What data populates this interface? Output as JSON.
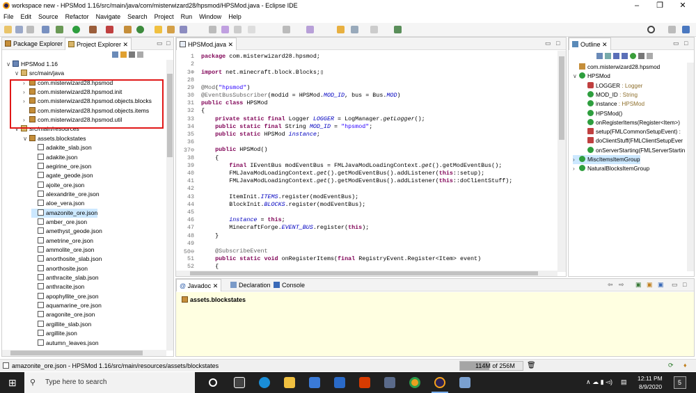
{
  "window": {
    "title": "workspace new - HPSMod 1.16/src/main/java/com/misterwizard28/hpsmod/HPSMod.java - Eclipse IDE",
    "minimize": "–",
    "restore": "❐",
    "close": "✕"
  },
  "menu": [
    "File",
    "Edit",
    "Source",
    "Refactor",
    "Navigate",
    "Search",
    "Project",
    "Run",
    "Window",
    "Help"
  ],
  "left_panel": {
    "tabs": [
      "Package Explorer",
      "Project Explorer"
    ],
    "tree": [
      {
        "label": "HPSMod 1.16",
        "indent": 0,
        "icon": "project",
        "arrow": "∨"
      },
      {
        "label": "src/main/java",
        "indent": 1,
        "icon": "folder",
        "arrow": "∨"
      },
      {
        "label": "com.misterwizard28.hpsmod",
        "indent": 2,
        "icon": "package",
        "arrow": "›"
      },
      {
        "label": "com.misterwizard28.hpsmod.init",
        "indent": 2,
        "icon": "package",
        "arrow": "›"
      },
      {
        "label": "com.misterwizard28.hpsmod.objects.blocks",
        "indent": 2,
        "icon": "package",
        "arrow": "›"
      },
      {
        "label": "com.misterwizard28.hpsmod.objects.items",
        "indent": 2,
        "icon": "package",
        "arrow": ""
      },
      {
        "label": "com.misterwizard28.hpsmod.util",
        "indent": 2,
        "icon": "package",
        "arrow": "›"
      },
      {
        "label": "src/main/resources",
        "indent": 1,
        "icon": "folder",
        "arrow": "∨"
      },
      {
        "label": "assets.blockstates",
        "indent": 2,
        "icon": "package",
        "arrow": "∨"
      },
      {
        "label": "adakite_slab.json",
        "indent": 3,
        "icon": "file",
        "arrow": ""
      },
      {
        "label": "adakite.json",
        "indent": 3,
        "icon": "file",
        "arrow": ""
      },
      {
        "label": "aegirine_ore.json",
        "indent": 3,
        "icon": "file",
        "arrow": ""
      },
      {
        "label": "agate_geode.json",
        "indent": 3,
        "icon": "file",
        "arrow": ""
      },
      {
        "label": "ajoite_ore.json",
        "indent": 3,
        "icon": "file",
        "arrow": ""
      },
      {
        "label": "alexandrite_ore.json",
        "indent": 3,
        "icon": "file",
        "arrow": ""
      },
      {
        "label": "aloe_vera.json",
        "indent": 3,
        "icon": "file",
        "arrow": ""
      },
      {
        "label": "amazonite_ore.json",
        "indent": 3,
        "icon": "file",
        "arrow": "",
        "selected": true
      },
      {
        "label": "amber_ore.json",
        "indent": 3,
        "icon": "file",
        "arrow": ""
      },
      {
        "label": "amethyst_geode.json",
        "indent": 3,
        "icon": "file",
        "arrow": ""
      },
      {
        "label": "ametrine_ore.json",
        "indent": 3,
        "icon": "file",
        "arrow": ""
      },
      {
        "label": "ammolite_ore.json",
        "indent": 3,
        "icon": "file",
        "arrow": ""
      },
      {
        "label": "anorthosite_slab.json",
        "indent": 3,
        "icon": "file",
        "arrow": ""
      },
      {
        "label": "anorthosite.json",
        "indent": 3,
        "icon": "file",
        "arrow": ""
      },
      {
        "label": "anthracite_slab.json",
        "indent": 3,
        "icon": "file",
        "arrow": ""
      },
      {
        "label": "anthracite.json",
        "indent": 3,
        "icon": "file",
        "arrow": ""
      },
      {
        "label": "apophyllite_ore.json",
        "indent": 3,
        "icon": "file",
        "arrow": ""
      },
      {
        "label": "aquamarine_ore.json",
        "indent": 3,
        "icon": "file",
        "arrow": ""
      },
      {
        "label": "aragonite_ore.json",
        "indent": 3,
        "icon": "file",
        "arrow": ""
      },
      {
        "label": "argillite_slab.json",
        "indent": 3,
        "icon": "file",
        "arrow": ""
      },
      {
        "label": "argillite.json",
        "indent": 3,
        "icon": "file",
        "arrow": ""
      },
      {
        "label": "autumn_leaves.json",
        "indent": 3,
        "icon": "file",
        "arrow": ""
      }
    ]
  },
  "editor": {
    "tab": "HPSMod.java",
    "lines": [
      {
        "n": "1",
        "html": "<span class=\"kw\">package</span> com.misterwizard28.hpsmod;"
      },
      {
        "n": "2",
        "html": ""
      },
      {
        "n": "3⊕",
        "html": "<span class=\"kw\">import</span> net.minecraft.block.Blocks;▯"
      },
      {
        "n": "28",
        "html": ""
      },
      {
        "n": "29",
        "html": "<span class=\"an\">@Mod</span>(<span class=\"st\">\"hpsmod\"</span>)"
      },
      {
        "n": "30",
        "html": "<span class=\"an\">@EventBusSubscriber</span>(modid = HPSMod.<span class=\"fi\">MOD_ID</span>, bus = Bus.<span class=\"fi\">MOD</span>)"
      },
      {
        "n": "31",
        "html": "<span class=\"kw\">public class</span> HPSMod"
      },
      {
        "n": "32",
        "html": "{"
      },
      {
        "n": "33",
        "html": "    <span class=\"kw\">private static final</span> Logger <span class=\"fi\">LOGGER</span> = LogManager.<span class=\"it\">getLogger</span>();"
      },
      {
        "n": "34",
        "html": "    <span class=\"kw\">public static final</span> String <span class=\"fi\">MOD_ID</span> = <span class=\"st\">\"hpsmod\"</span>;"
      },
      {
        "n": "35",
        "html": "    <span class=\"kw\">public static</span> HPSMod <span class=\"fi\">instance</span>;"
      },
      {
        "n": "36",
        "html": ""
      },
      {
        "n": "37⊖",
        "html": "    <span class=\"kw\">public</span> HPSMod()"
      },
      {
        "n": "38",
        "html": "    {"
      },
      {
        "n": "39",
        "html": "        <span class=\"kw\">final</span> IEventBus modEventBus = FMLJavaModLoadingContext.<span class=\"it\">get</span>().getModEventBus();"
      },
      {
        "n": "40",
        "html": "        FMLJavaModLoadingContext.<span class=\"it\">get</span>().getModEventBus().addListener(<span class=\"kw\">this</span>::setup);"
      },
      {
        "n": "41",
        "html": "        FMLJavaModLoadingContext.<span class=\"it\">get</span>().getModEventBus().addListener(<span class=\"kw\">this</span>::doClientStuff);"
      },
      {
        "n": "42",
        "html": ""
      },
      {
        "n": "43",
        "html": "        ItemInit.<span class=\"fi\">ITEMS</span>.register(modEventBus);"
      },
      {
        "n": "44",
        "html": "        BlockInit.<span class=\"fi\">BLOCKS</span>.register(modEventBus);"
      },
      {
        "n": "45",
        "html": ""
      },
      {
        "n": "46",
        "html": "        <span class=\"fi\">instance</span> = <span class=\"kw\">this</span>;"
      },
      {
        "n": "47",
        "html": "        MinecraftForge.<span class=\"fi\">EVENT_BUS</span>.register(<span class=\"kw\">this</span>);"
      },
      {
        "n": "48",
        "html": "    }"
      },
      {
        "n": "49",
        "html": ""
      },
      {
        "n": "50⊖",
        "html": "    <span class=\"an\">@SubscribeEvent</span>"
      },
      {
        "n": "51",
        "html": "    <span class=\"kw\">public static void</span> onRegisterItems(<span class=\"kw\">final</span> RegistryEvent.Register&lt;Item&gt; event)"
      },
      {
        "n": "52",
        "html": "    {"
      }
    ]
  },
  "outline": {
    "tab": "Outline",
    "items": [
      {
        "label": "com.misterwizard28.hpsmod",
        "type": "",
        "indent": 0,
        "arrow": "",
        "icon": "package"
      },
      {
        "label": "HPSMod",
        "type": "",
        "indent": 0,
        "arrow": "∨",
        "icon": "class"
      },
      {
        "label": "LOGGER",
        "type": " : Logger",
        "indent": 1,
        "arrow": "",
        "icon": "field-private"
      },
      {
        "label": "MOD_ID",
        "type": " : String",
        "indent": 1,
        "arrow": "",
        "icon": "field-public"
      },
      {
        "label": "instance",
        "type": " : HPSMod",
        "indent": 1,
        "arrow": "",
        "icon": "field-public"
      },
      {
        "label": "HPSMod()",
        "type": "",
        "indent": 1,
        "arrow": "",
        "icon": "method-public"
      },
      {
        "label": "onRegisterItems(Register<Item>)",
        "type": "",
        "indent": 1,
        "arrow": "",
        "icon": "method-public"
      },
      {
        "label": "setup(FMLCommonSetupEvent) :",
        "type": "",
        "indent": 1,
        "arrow": "",
        "icon": "method-private"
      },
      {
        "label": "doClientStuff(FMLClientSetupEver",
        "type": "",
        "indent": 1,
        "arrow": "",
        "icon": "method-private"
      },
      {
        "label": "onServerStarting(FMLServerStartin",
        "type": "",
        "indent": 1,
        "arrow": "",
        "icon": "method-public"
      },
      {
        "label": "MiscItemsItemGroup",
        "type": "",
        "indent": 0,
        "arrow": "›",
        "icon": "class",
        "selected": true
      },
      {
        "label": "NaturalBlocksItemGroup",
        "type": "",
        "indent": 0,
        "arrow": "›",
        "icon": "class"
      }
    ]
  },
  "bottom": {
    "tabs": [
      "Javadoc",
      "Declaration",
      "Console"
    ],
    "content": "assets.blockstates"
  },
  "status": {
    "path": "amazonite_ore.json - HPSMod 1.16/src/main/resources/assets/blockstates",
    "heap": "114M of 256M"
  },
  "taskbar": {
    "search_placeholder": "Type here to search",
    "time": "12:11 PM",
    "date": "8/9/2020",
    "notification_count": "5"
  },
  "colors": {
    "accent": "#2c2255",
    "selection": "#cce8ff",
    "highlight_box": "#e01717",
    "javadoc_bg": "#ffffe1"
  }
}
